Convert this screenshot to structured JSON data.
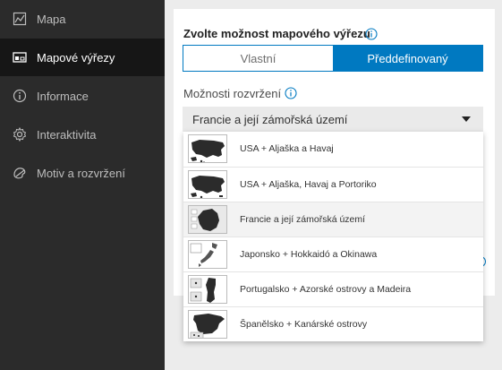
{
  "sidebar": {
    "items": [
      {
        "label": "Mapa",
        "icon": "map-icon"
      },
      {
        "label": "Mapové výřezy",
        "icon": "map-frames-icon"
      },
      {
        "label": "Informace",
        "icon": "info-icon"
      },
      {
        "label": "Interaktivita",
        "icon": "gear-icon"
      },
      {
        "label": "Motiv a rozvržení",
        "icon": "palette-icon"
      }
    ],
    "active_index": 1
  },
  "panel": {
    "choose_label": "Zvolte možnost mapového výřezu",
    "segments": {
      "custom": "Vlastní",
      "predefined": "Předdefinovaný",
      "selected": "predefined"
    },
    "layout_label": "Možnosti rozvržení",
    "select_value": "Francie a její zámořská území"
  },
  "dropdown": {
    "options": [
      {
        "label": "USA + Aljaška a Havaj",
        "thumb": "usa-map-thumbnail"
      },
      {
        "label": "USA + Aljaška, Havaj a Portoriko",
        "thumb": "usa-map-thumbnail"
      },
      {
        "label": "Francie a její zámořská území",
        "thumb": "france-map-thumbnail"
      },
      {
        "label": "Japonsko + Hokkaidó a Okinawa",
        "thumb": "japan-map-thumbnail"
      },
      {
        "label": "Portugalsko + Azorské ostrovy a Madeira",
        "thumb": "portugal-map-thumbnail"
      },
      {
        "label": "Španělsko + Kanárské ostrovy",
        "thumb": "spain-map-thumbnail"
      }
    ],
    "highlighted_index": 2
  },
  "colors": {
    "accent": "#0079c1",
    "sidebar_bg": "#2b2b2b",
    "sidebar_active": "#161616"
  }
}
